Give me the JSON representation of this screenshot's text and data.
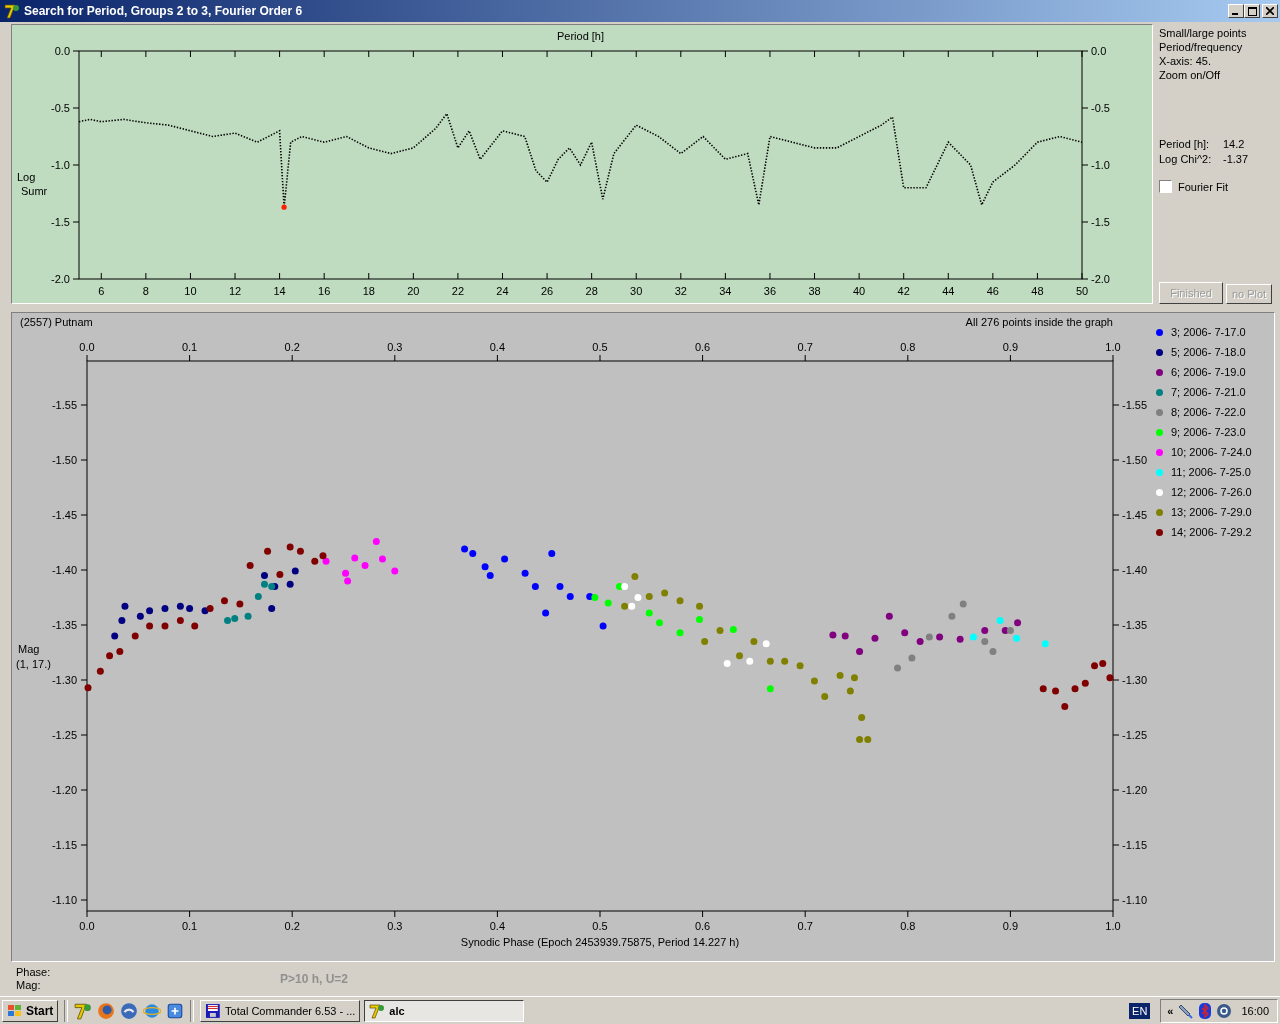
{
  "window": {
    "title": "Search for Period, Groups 2 to 3, Fourier Order 6"
  },
  "periodogram": {
    "chart_data": {
      "type": "line",
      "title": "Period [h]",
      "ylabel": "Log Sumr",
      "xlim": [
        5,
        50
      ],
      "ylim": [
        -2,
        0
      ],
      "xticks": [
        6,
        8,
        10,
        12,
        14,
        16,
        18,
        20,
        22,
        24,
        26,
        28,
        30,
        32,
        34,
        36,
        38,
        40,
        42,
        44,
        46,
        48,
        50
      ],
      "yticks": [
        {
          "value": 0,
          "label": "0.0"
        },
        {
          "value": -0.5,
          "label": "-0.5"
        },
        {
          "value": -1,
          "label": "-1.0"
        },
        {
          "value": -1.5,
          "label": "-1.5"
        },
        {
          "value": -2,
          "label": "-2.0"
        }
      ],
      "x": [
        5,
        5.5,
        6,
        7,
        8,
        9,
        10,
        11,
        12,
        13,
        14,
        14.2,
        14.5,
        15,
        16,
        17,
        18,
        19,
        20,
        21,
        21.5,
        22,
        22.5,
        23,
        24,
        25,
        25.5,
        26,
        26.5,
        27,
        27.5,
        28,
        28.5,
        29,
        30,
        31,
        32,
        33,
        34,
        35,
        35.5,
        36,
        37,
        38,
        39,
        40,
        41,
        41.5,
        42,
        43,
        44,
        45,
        45.5,
        46,
        47,
        48,
        49,
        50
      ],
      "series": [
        {
          "color": "#000000",
          "line_style": "dotted",
          "values": [
            -0.62,
            -0.6,
            -0.62,
            -0.6,
            -0.63,
            -0.65,
            -0.7,
            -0.75,
            -0.72,
            -0.8,
            -0.7,
            -1.37,
            -0.8,
            -0.75,
            -0.8,
            -0.75,
            -0.85,
            -0.9,
            -0.85,
            -0.68,
            -0.55,
            -0.85,
            -0.7,
            -0.95,
            -0.7,
            -0.75,
            -1.05,
            -1.15,
            -0.95,
            -0.85,
            -1.0,
            -0.8,
            -1.3,
            -0.9,
            -0.65,
            -0.75,
            -0.9,
            -0.75,
            -0.95,
            -0.9,
            -1.35,
            -0.75,
            -0.8,
            -0.85,
            -0.85,
            -0.75,
            -0.65,
            -0.58,
            -1.2,
            -1.2,
            -0.8,
            -1.0,
            -1.35,
            -1.15,
            -1.0,
            -0.8,
            -0.75,
            -0.8
          ]
        }
      ]
    }
  },
  "side_panel": {
    "options": [
      "Small/large points",
      "Period/frequency",
      "X-axis: 45.",
      "Zoom on/Off"
    ],
    "readouts": [
      {
        "label": "Period [h]:",
        "value": "14.2"
      },
      {
        "label": "Log Chi^2:",
        "value": "-1.37"
      }
    ],
    "fourier_fit": {
      "label": "Fourier Fit",
      "checked": false
    },
    "buttons": [
      {
        "label": "Finished",
        "disabled": true
      },
      {
        "label": "no Plot",
        "disabled": true
      }
    ]
  },
  "lightcurve": {
    "object": "(2557) Putnam",
    "points_note": "All 276 points inside the graph",
    "chart_data": {
      "type": "scatter",
      "legend": "right",
      "xlabel": "Synodic Phase (Epoch 2453939.75875, Period 14.227 h)",
      "ylabel": "Mag (1, 17.)",
      "xlim": [
        0,
        1
      ],
      "ylim": [
        -1.09,
        -1.59
      ],
      "xticks": [
        {
          "value": 0,
          "label": "0.0"
        },
        {
          "value": 0.1,
          "label": "0.1"
        },
        {
          "value": 0.2,
          "label": "0.2"
        },
        {
          "value": 0.3,
          "label": "0.3"
        },
        {
          "value": 0.4,
          "label": "0.4"
        },
        {
          "value": 0.5,
          "label": "0.5"
        },
        {
          "value": 0.6,
          "label": "0.6"
        },
        {
          "value": 0.7,
          "label": "0.7"
        },
        {
          "value": 0.8,
          "label": "0.8"
        },
        {
          "value": 0.9,
          "label": "0.9"
        },
        {
          "value": 1,
          "label": "1.0"
        }
      ],
      "yticks": [
        {
          "value": -1.55,
          "label": "-1.55"
        },
        {
          "value": -1.5,
          "label": "-1.50"
        },
        {
          "value": -1.45,
          "label": "-1.45"
        },
        {
          "value": -1.4,
          "label": "-1.40"
        },
        {
          "value": -1.35,
          "label": "-1.35"
        },
        {
          "value": -1.3,
          "label": "-1.30"
        },
        {
          "value": -1.25,
          "label": "-1.25"
        },
        {
          "value": -1.2,
          "label": "-1.20"
        },
        {
          "value": -1.15,
          "label": "-1.15"
        },
        {
          "value": -1.1,
          "label": "-1.10"
        }
      ],
      "series": [
        {
          "name": "3; 2006- 7-17.0",
          "color": "#0000ff",
          "x": [
            0.368,
            0.376,
            0.388,
            0.393,
            0.407,
            0.427,
            0.437,
            0.453,
            0.461,
            0.471,
            0.49,
            0.503,
            0.447
          ],
          "values": [
            -1.419,
            -1.415,
            -1.403,
            -1.395,
            -1.41,
            -1.397,
            -1.385,
            -1.415,
            -1.385,
            -1.376,
            -1.376,
            -1.349,
            -1.361
          ]
        },
        {
          "name": "5; 2006- 7-18.0",
          "color": "#000080",
          "x": [
            0.027,
            0.034,
            0.037,
            0.052,
            0.061,
            0.076,
            0.091,
            0.1,
            0.115,
            0.173,
            0.183,
            0.198,
            0.203,
            0.18
          ],
          "values": [
            -1.34,
            -1.354,
            -1.367,
            -1.358,
            -1.363,
            -1.365,
            -1.367,
            -1.365,
            -1.363,
            -1.395,
            -1.385,
            -1.387,
            -1.399,
            -1.365
          ]
        },
        {
          "name": "6; 2006- 7-19.0",
          "color": "#800080",
          "x": [
            0.727,
            0.739,
            0.753,
            0.768,
            0.782,
            0.797,
            0.812,
            0.831,
            0.851,
            0.875,
            0.895,
            0.907
          ],
          "values": [
            -1.341,
            -1.34,
            -1.326,
            -1.338,
            -1.358,
            -1.343,
            -1.335,
            -1.339,
            -1.337,
            -1.345,
            -1.345,
            -1.352
          ]
        },
        {
          "name": "7; 2006- 7-21.0",
          "color": "#008080",
          "x": [
            0.137,
            0.144,
            0.157,
            0.167,
            0.173,
            0.18
          ],
          "values": [
            -1.354,
            -1.356,
            -1.358,
            -1.376,
            -1.387,
            -1.385
          ]
        },
        {
          "name": "8; 2006- 7-22.0",
          "color": "#808080",
          "x": [
            0.79,
            0.804,
            0.821,
            0.843,
            0.854,
            0.875,
            0.883,
            0.9
          ],
          "values": [
            -1.311,
            -1.32,
            -1.339,
            -1.358,
            -1.369,
            -1.335,
            -1.326,
            -1.345
          ]
        },
        {
          "name": "9; 2006- 7-23.0",
          "color": "#00ff00",
          "x": [
            0.495,
            0.508,
            0.519,
            0.548,
            0.558,
            0.578,
            0.597,
            0.63,
            0.666
          ],
          "values": [
            -1.375,
            -1.37,
            -1.385,
            -1.361,
            -1.352,
            -1.343,
            -1.355,
            -1.346,
            -1.292
          ]
        },
        {
          "name": "10; 2006- 7-24.0",
          "color": "#ff00ff",
          "x": [
            0.233,
            0.252,
            0.261,
            0.271,
            0.282,
            0.288,
            0.3,
            0.254
          ],
          "values": [
            -1.408,
            -1.397,
            -1.411,
            -1.404,
            -1.426,
            -1.41,
            -1.399,
            -1.39
          ]
        },
        {
          "name": "11; 2006- 7-25.0",
          "color": "#00ffff",
          "x": [
            0.864,
            0.89,
            0.906,
            0.934
          ],
          "values": [
            -1.339,
            -1.354,
            -1.338,
            -1.333
          ]
        },
        {
          "name": "12; 2006- 7-26.0",
          "color": "#ffffff",
          "x": [
            0.524,
            0.531,
            0.537,
            0.624,
            0.646,
            0.662
          ],
          "values": [
            -1.385,
            -1.367,
            -1.375,
            -1.315,
            -1.317,
            -1.333
          ]
        },
        {
          "name": "13; 2006- 7-29.0",
          "color": "#808000",
          "x": [
            0.524,
            0.534,
            0.548,
            0.563,
            0.578,
            0.597,
            0.602,
            0.617,
            0.636,
            0.65,
            0.666,
            0.68,
            0.695,
            0.709,
            0.719,
            0.734,
            0.744,
            0.755,
            0.753,
            0.761,
            0.748
          ],
          "values": [
            -1.367,
            -1.394,
            -1.376,
            -1.379,
            -1.372,
            -1.367,
            -1.335,
            -1.345,
            -1.322,
            -1.335,
            -1.317,
            -1.317,
            -1.313,
            -1.299,
            -1.285,
            -1.304,
            -1.29,
            -1.266,
            -1.246,
            -1.246,
            -1.302
          ]
        },
        {
          "name": "14; 2006- 7-29.2",
          "color": "#800000",
          "x": [
            0.001,
            0.013,
            0.022,
            0.032,
            0.047,
            0.061,
            0.076,
            0.091,
            0.105,
            0.12,
            0.134,
            0.149,
            0.159,
            0.176,
            0.188,
            0.198,
            0.208,
            0.222,
            0.23,
            0.932,
            0.944,
            0.953,
            0.963,
            0.973,
            0.982,
            0.99,
            0.997
          ],
          "values": [
            -1.293,
            -1.308,
            -1.322,
            -1.326,
            -1.34,
            -1.349,
            -1.349,
            -1.354,
            -1.349,
            -1.365,
            -1.372,
            -1.369,
            -1.404,
            -1.417,
            -1.396,
            -1.421,
            -1.417,
            -1.408,
            -1.413,
            -1.292,
            -1.29,
            -1.276,
            -1.292,
            -1.297,
            -1.313,
            -1.315,
            -1.302
          ]
        }
      ]
    }
  },
  "status": {
    "phase_label": "Phase:",
    "mag_label": "Mag:",
    "hint": "P>10 h, U=2"
  },
  "taskbar": {
    "start": "Start",
    "tasks": [
      {
        "label": "Total Commander 6.53 - ...",
        "kind": "floppy",
        "selected": false
      },
      {
        "label": "alc",
        "kind": "app",
        "selected": true
      }
    ],
    "language": "EN",
    "tray_toggle": "«",
    "clock": "16:00"
  }
}
